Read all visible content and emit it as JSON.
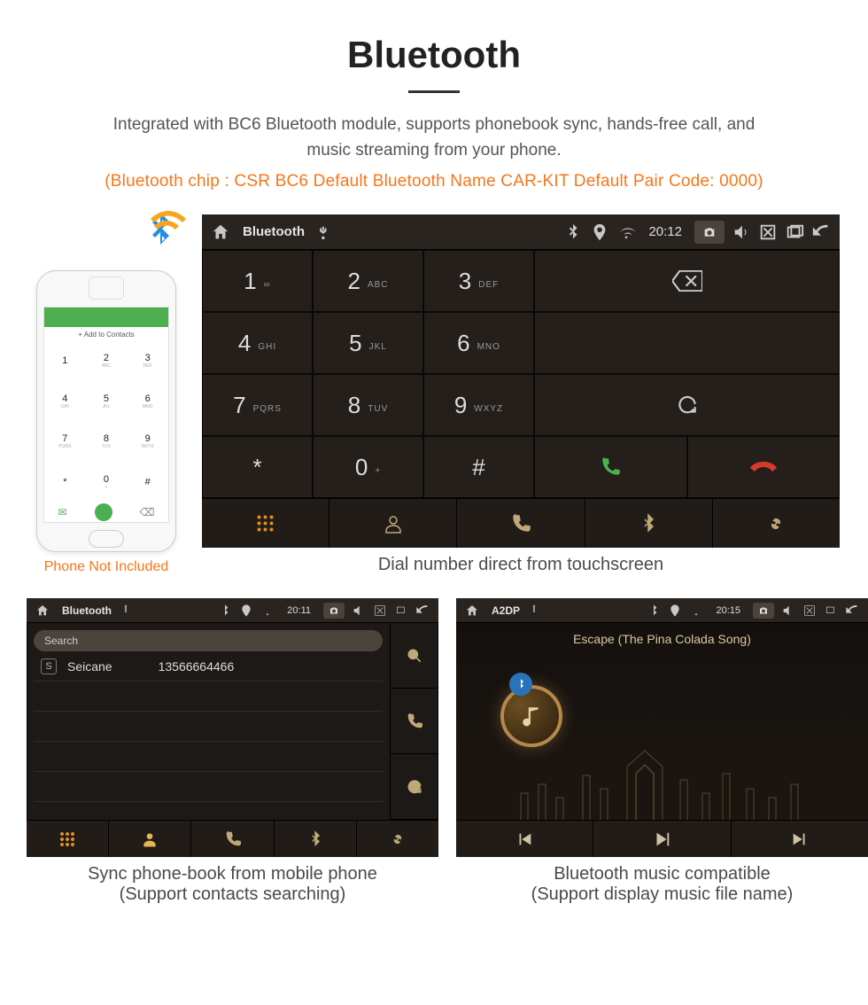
{
  "page": {
    "title": "Bluetooth",
    "desc1": "Integrated with BC6 Bluetooth module, supports phonebook sync, hands-free call, and",
    "desc2": "music streaming from your phone.",
    "orange": "(Bluetooth chip : CSR BC6     Default Bluetooth Name CAR-KIT     Default Pair Code: 0000)"
  },
  "phone": {
    "add_contacts": "+  Add to Contacts",
    "keys": [
      {
        "n": "1",
        "s": ""
      },
      {
        "n": "2",
        "s": "ABC"
      },
      {
        "n": "3",
        "s": "DEF"
      },
      {
        "n": "4",
        "s": "GHI"
      },
      {
        "n": "5",
        "s": "JKL"
      },
      {
        "n": "6",
        "s": "MNO"
      },
      {
        "n": "7",
        "s": "PQRS"
      },
      {
        "n": "8",
        "s": "TUV"
      },
      {
        "n": "9",
        "s": "WXYZ"
      },
      {
        "n": "*",
        "s": ""
      },
      {
        "n": "0",
        "s": "+"
      },
      {
        "n": "#",
        "s": ""
      }
    ],
    "caption": "Phone Not Included"
  },
  "hu_top": {
    "title": "Bluetooth",
    "time": "20:12"
  },
  "dialer": {
    "keys": [
      {
        "n": "1",
        "s": "∞"
      },
      {
        "n": "2",
        "s": "ABC"
      },
      {
        "n": "3",
        "s": "DEF"
      },
      {
        "n": "4",
        "s": "GHI"
      },
      {
        "n": "5",
        "s": "JKL"
      },
      {
        "n": "6",
        "s": "MNO"
      },
      {
        "n": "7",
        "s": "PQRS"
      },
      {
        "n": "8",
        "s": "TUV"
      },
      {
        "n": "9",
        "s": "WXYZ"
      },
      {
        "n": "*",
        "s": ""
      },
      {
        "n": "0",
        "s": "+"
      },
      {
        "n": "#",
        "s": ""
      }
    ],
    "caption": "Dial number direct from touchscreen"
  },
  "phonebook": {
    "topbar_title": "Bluetooth",
    "topbar_time": "20:11",
    "search_placeholder": "Search",
    "contact_name": "Seicane",
    "contact_number": "13566664466",
    "caption1": "Sync phone-book from mobile phone",
    "caption2": "(Support contacts searching)"
  },
  "music": {
    "topbar_title": "A2DP",
    "topbar_time": "20:15",
    "song": "Escape (The Pina Colada Song)",
    "caption1": "Bluetooth music compatible",
    "caption2": "(Support display music file name)"
  }
}
